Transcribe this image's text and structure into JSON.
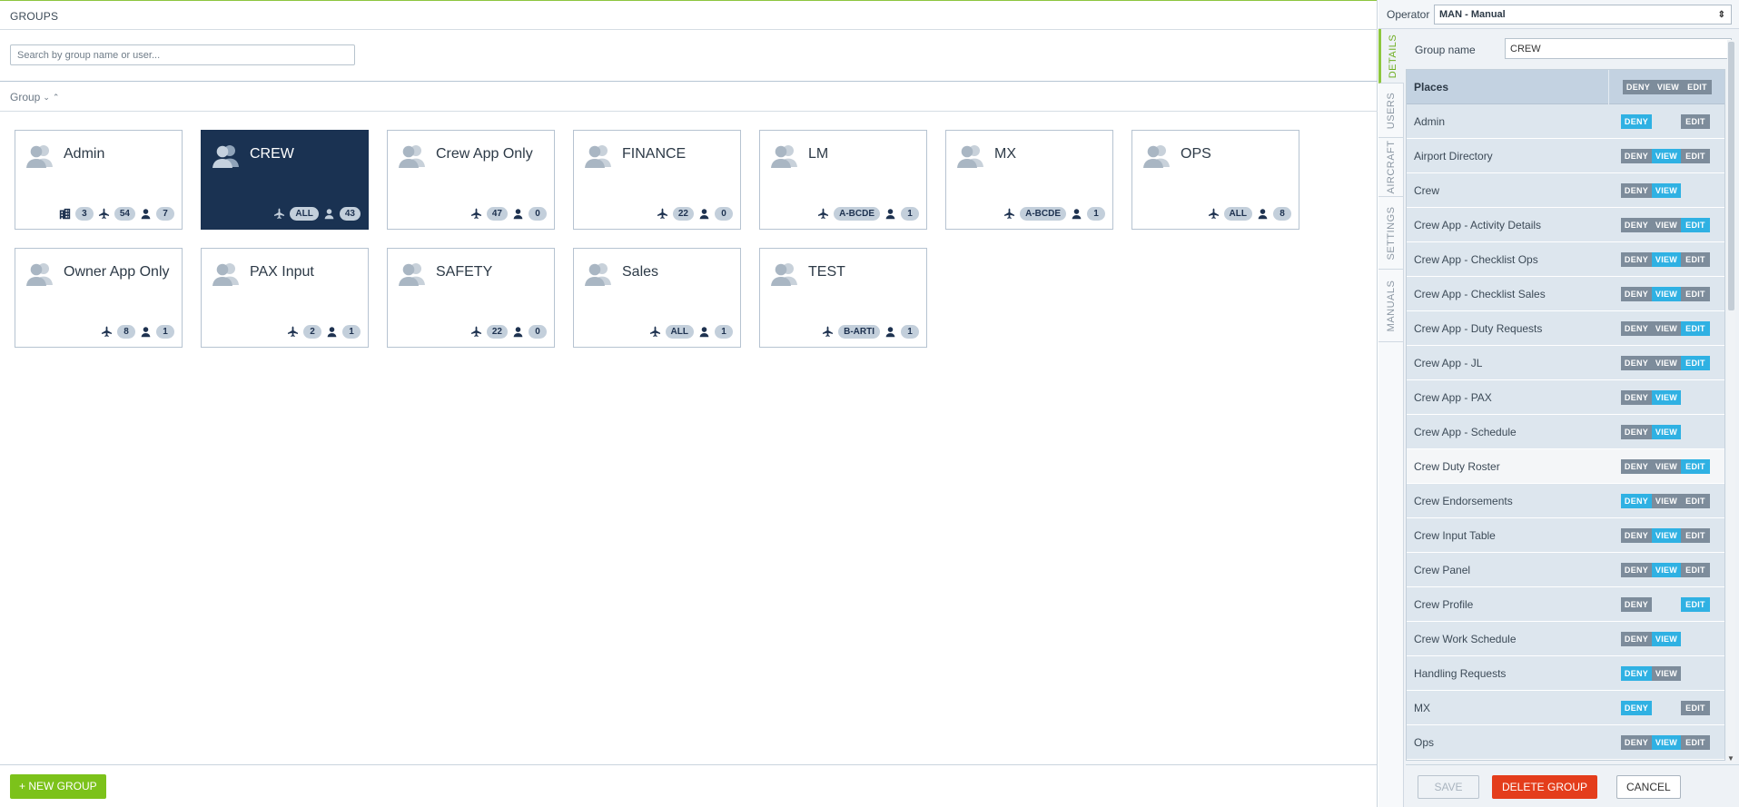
{
  "main": {
    "title": "GROUPS",
    "search_placeholder": "Search by group name or user...",
    "sort_label": "Group",
    "new_group_label": "+ NEW GROUP"
  },
  "groups": [
    {
      "name": "Admin",
      "stats": [
        {
          "icon": "building-icon",
          "value": "3"
        },
        {
          "icon": "plane-icon",
          "value": "54"
        },
        {
          "icon": "user-icon",
          "value": "7"
        }
      ]
    },
    {
      "name": "CREW",
      "selected": true,
      "stats": [
        {
          "icon": "plane-icon",
          "value": "ALL"
        },
        {
          "icon": "user-icon",
          "value": "43"
        }
      ]
    },
    {
      "name": "Crew App Only",
      "stats": [
        {
          "icon": "plane-icon",
          "value": "47"
        },
        {
          "icon": "user-icon",
          "value": "0"
        }
      ]
    },
    {
      "name": "FINANCE",
      "stats": [
        {
          "icon": "plane-icon",
          "value": "22"
        },
        {
          "icon": "user-icon",
          "value": "0"
        }
      ]
    },
    {
      "name": "LM",
      "stats": [
        {
          "icon": "plane-icon",
          "value": "A-BCDE"
        },
        {
          "icon": "user-icon",
          "value": "1"
        }
      ]
    },
    {
      "name": "MX",
      "stats": [
        {
          "icon": "plane-icon",
          "value": "A-BCDE"
        },
        {
          "icon": "user-icon",
          "value": "1"
        }
      ]
    },
    {
      "name": "OPS",
      "stats": [
        {
          "icon": "plane-icon",
          "value": "ALL"
        },
        {
          "icon": "user-icon",
          "value": "8"
        }
      ]
    },
    {
      "name": "Owner App Only",
      "stats": [
        {
          "icon": "plane-icon",
          "value": "8"
        },
        {
          "icon": "user-icon",
          "value": "1"
        }
      ]
    },
    {
      "name": "PAX Input",
      "stats": [
        {
          "icon": "plane-icon",
          "value": "2"
        },
        {
          "icon": "user-icon",
          "value": "1"
        }
      ]
    },
    {
      "name": "SAFETY",
      "stats": [
        {
          "icon": "plane-icon",
          "value": "22"
        },
        {
          "icon": "user-icon",
          "value": "0"
        }
      ]
    },
    {
      "name": "Sales",
      "stats": [
        {
          "icon": "plane-icon",
          "value": "ALL"
        },
        {
          "icon": "user-icon",
          "value": "1"
        }
      ]
    },
    {
      "name": "TEST",
      "stats": [
        {
          "icon": "plane-icon",
          "value": "B-ARTI"
        },
        {
          "icon": "user-icon",
          "value": "1"
        }
      ]
    }
  ],
  "right": {
    "operator_label": "Operator",
    "operator_value": "MAN - Manual",
    "tabs": [
      "DETAILS",
      "USERS",
      "AIRCRAFT",
      "SETTINGS",
      "MANUALS"
    ],
    "active_tab": "DETAILS",
    "group_name_label": "Group name",
    "group_name_value": "CREW",
    "places_header": "Places",
    "btn_labels": {
      "deny": "DENY",
      "view": "VIEW",
      "edit": "EDIT"
    },
    "places": [
      {
        "name": "Admin",
        "deny": "on",
        "view": "none",
        "edit": "off"
      },
      {
        "name": "Airport Directory",
        "deny": "off",
        "view": "on",
        "edit": "off"
      },
      {
        "name": "Crew",
        "deny": "off",
        "view": "on",
        "edit": "none"
      },
      {
        "name": "Crew App - Activity Details",
        "deny": "off",
        "view": "off",
        "edit": "on"
      },
      {
        "name": "Crew App - Checklist Ops",
        "deny": "off",
        "view": "on",
        "edit": "off"
      },
      {
        "name": "Crew App - Checklist Sales",
        "deny": "off",
        "view": "on",
        "edit": "off"
      },
      {
        "name": "Crew App - Duty Requests",
        "deny": "off",
        "view": "off",
        "edit": "on"
      },
      {
        "name": "Crew App - JL",
        "deny": "off",
        "view": "off",
        "edit": "on"
      },
      {
        "name": "Crew App - PAX",
        "deny": "off",
        "view": "on",
        "edit": "none"
      },
      {
        "name": "Crew App - Schedule",
        "deny": "off",
        "view": "on",
        "edit": "none"
      },
      {
        "name": "Crew Duty Roster",
        "deny": "off",
        "view": "off",
        "edit": "on",
        "hover": true
      },
      {
        "name": "Crew Endorsements",
        "deny": "on",
        "view": "off",
        "edit": "off"
      },
      {
        "name": "Crew Input Table",
        "deny": "off",
        "view": "on",
        "edit": "off"
      },
      {
        "name": "Crew Panel",
        "deny": "off",
        "view": "on",
        "edit": "off"
      },
      {
        "name": "Crew Profile",
        "deny": "off",
        "view": "none",
        "edit": "on"
      },
      {
        "name": "Crew Work Schedule",
        "deny": "off",
        "view": "on",
        "edit": "none"
      },
      {
        "name": "Handling Requests",
        "deny": "on",
        "view": "off",
        "edit": "none"
      },
      {
        "name": "MX",
        "deny": "on",
        "view": "none",
        "edit": "off"
      },
      {
        "name": "Ops",
        "deny": "off",
        "view": "on",
        "edit": "off"
      }
    ],
    "save_label": "SAVE",
    "delete_label": "DELETE GROUP",
    "cancel_label": "CANCEL"
  },
  "colors": {
    "accent_green": "#7cc21a",
    "selected_tile": "#1a3252",
    "perm_on": "#2fb1e3",
    "perm_off": "#7d8c9b",
    "danger": "#e43d1b"
  }
}
